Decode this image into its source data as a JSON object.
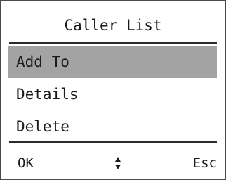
{
  "screen": {
    "title": "Caller List"
  },
  "menu": {
    "items": [
      {
        "label": "Add To",
        "selected": true
      },
      {
        "label": "Details",
        "selected": false
      },
      {
        "label": "Delete",
        "selected": false
      }
    ]
  },
  "softkeys": {
    "left_label": "OK",
    "center_icon": "up-down-arrows-icon",
    "right_label": "Esc"
  },
  "colors": {
    "selection": "#a3a3a3",
    "border": "#4a4a4a",
    "text": "#1a1a1a"
  }
}
